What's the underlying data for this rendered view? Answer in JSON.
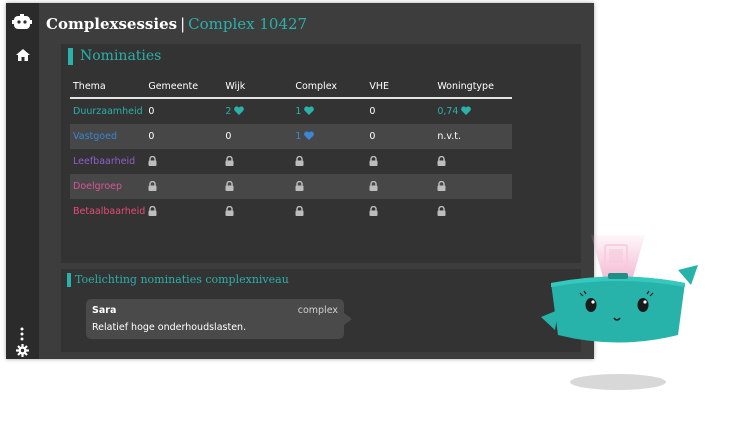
{
  "header": {
    "title": "Complexsessies",
    "separator": "|",
    "subtitle": "Complex 10427"
  },
  "sidebar": {
    "logo_icon": "robot-logo-icon",
    "items": [
      {
        "icon": "home-icon"
      }
    ],
    "bottom": [
      {
        "icon": "more-vertical-icon"
      },
      {
        "icon": "gear-icon"
      }
    ]
  },
  "nominaties": {
    "title": "Nominaties",
    "columns": [
      "Thema",
      "Gemeente",
      "Wijk",
      "Complex",
      "VHE",
      "Woningtype"
    ],
    "rows": [
      {
        "thema": "Duurzaamheid",
        "color": "#2ab1a9",
        "gemeente": "0",
        "wijk": "2",
        "complex": "1",
        "vhe": "0",
        "woningtype": "0,74",
        "hearts": {
          "wijk": "#2ab1a9",
          "complex": "#2ab1a9",
          "woningtype": "#2ab1a9"
        }
      },
      {
        "thema": "Vastgoed",
        "color": "#3b86d6",
        "gemeente": "0",
        "wijk": "0",
        "complex": "1",
        "vhe": "0",
        "woningtype": "n.v.t.",
        "hearts": {
          "complex": "#3b86d6"
        }
      },
      {
        "thema": "Leefbaarheid",
        "color": "#8f5fc9",
        "locked": true
      },
      {
        "thema": "Doelgroep",
        "color": "#d9559a",
        "locked": true
      },
      {
        "thema": "Betaalbaarheid",
        "color": "#e84b73",
        "locked": true
      }
    ]
  },
  "toelichting": {
    "title": "Toelichting nominaties complexniveau",
    "comment": {
      "author": "Sara",
      "level": "complex",
      "text": "Relatief hoge onderhoudslasten."
    }
  },
  "colors": {
    "accent": "#2ab1a9",
    "background": "#3d3d3d",
    "panel": "#333333"
  }
}
